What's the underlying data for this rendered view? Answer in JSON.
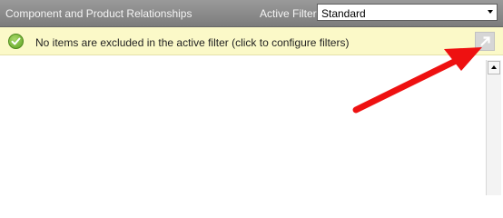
{
  "header": {
    "title": "Component and Product Relationships",
    "filter_label": "Active Filter",
    "filter_value": "Standard"
  },
  "notice": {
    "text": "No items are excluded in the active filter (click to configure filters)",
    "icon": "check-circle-icon",
    "button_icon": "arrow-up-right-icon"
  },
  "annotation": {
    "color": "#ee1111"
  }
}
